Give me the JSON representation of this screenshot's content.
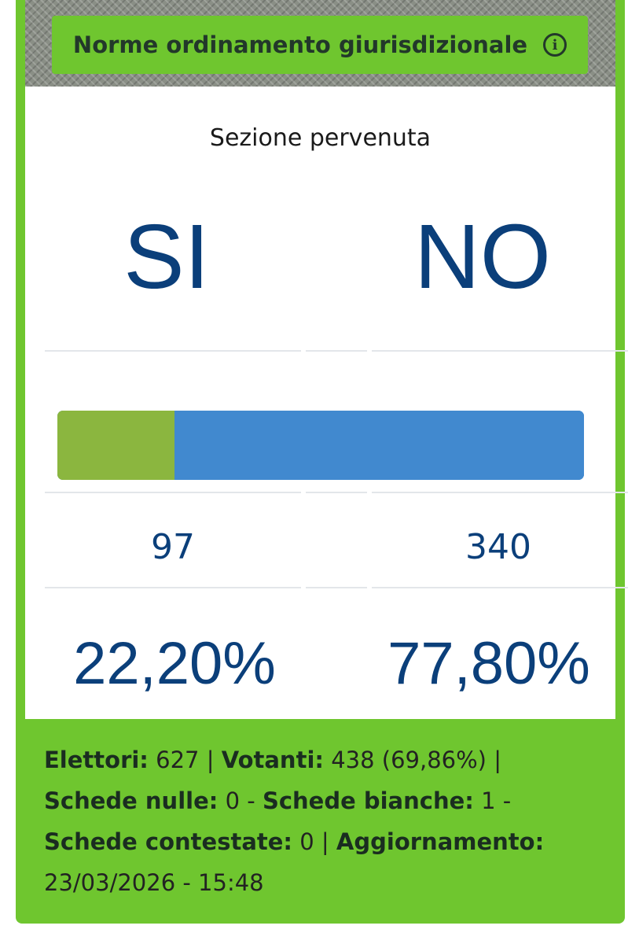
{
  "header": {
    "title": "Norme ordinamento giurisdizionale",
    "info_icon": "info-circle-icon"
  },
  "status": "Sezione pervenuta",
  "options": {
    "si": {
      "label": "SI",
      "votes": "97",
      "percent": "22,20%",
      "color": "#8bb63f",
      "share": 0.222
    },
    "no": {
      "label": "NO",
      "votes": "340",
      "percent": "77,80%",
      "color": "#4189cf",
      "share": 0.778
    }
  },
  "footer": {
    "elettori_label": "Elettori:",
    "elettori_value": "627",
    "votanti_label": "Votanti:",
    "votanti_value": "438 (69,86%)",
    "nulle_label": "Schede nulle:",
    "nulle_value": "0",
    "bianche_label": "Schede bianche:",
    "bianche_value": "1",
    "contestate_label": "Schede contestate:",
    "contestate_value": "0",
    "aggiornamento_label": "Aggiornamento:",
    "aggiornamento_value": "23/03/2026 - 15:48"
  },
  "colors": {
    "accent_green": "#6fc62f",
    "text_blue": "#0b3f7a"
  }
}
